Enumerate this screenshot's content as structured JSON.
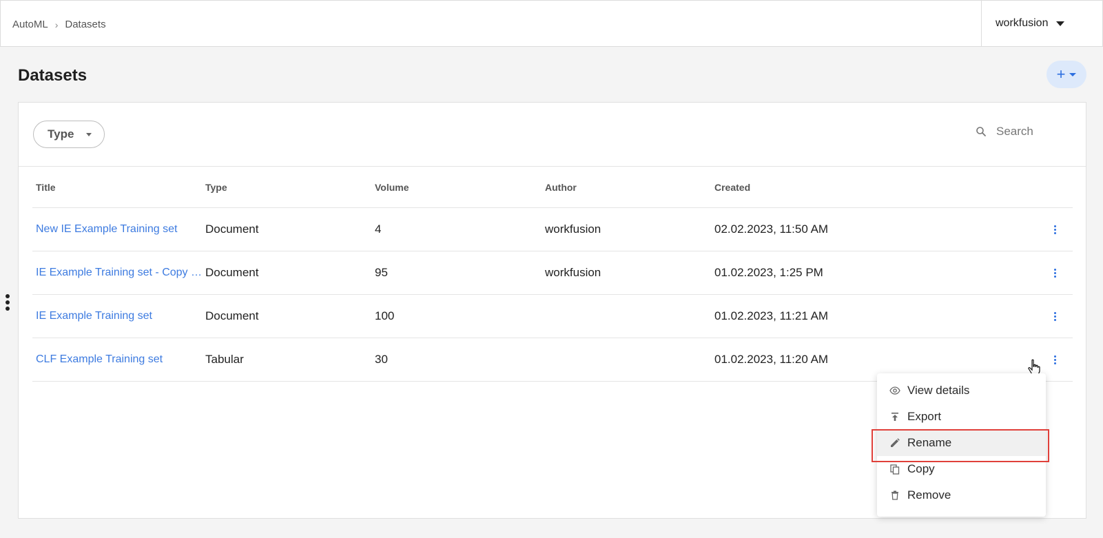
{
  "breadcrumb": {
    "root": "AutoML",
    "current": "Datasets"
  },
  "user": {
    "name": "workfusion"
  },
  "page": {
    "title": "Datasets",
    "add_label": "+"
  },
  "filters": {
    "type_label": "Type",
    "search_placeholder": "Search"
  },
  "table": {
    "headers": [
      "Title",
      "Type",
      "Volume",
      "Author",
      "Created"
    ],
    "rows": [
      {
        "title": "New IE Example Training set",
        "type": "Document",
        "volume": "4",
        "author": "workfusion",
        "created": "02.02.2023, 11:50 AM"
      },
      {
        "title": "IE Example Training set - Copy of IE Example Training set",
        "type": "Document",
        "volume": "95",
        "author": "workfusion",
        "created": "01.02.2023, 1:25 PM"
      },
      {
        "title": "IE Example Training set",
        "type": "Document",
        "volume": "100",
        "author": "",
        "created": "01.02.2023, 11:21 AM"
      },
      {
        "title": "CLF Example Training set",
        "type": "Tabular",
        "volume": "30",
        "author": "",
        "created": "01.02.2023, 11:20 AM"
      }
    ]
  },
  "context_menu": {
    "items": [
      {
        "label": "View details",
        "icon": "eye-icon"
      },
      {
        "label": "Export",
        "icon": "export-icon"
      },
      {
        "label": "Rename",
        "icon": "pencil-icon"
      },
      {
        "label": "Copy",
        "icon": "copy-icon"
      },
      {
        "label": "Remove",
        "icon": "trash-icon"
      }
    ],
    "highlighted": "Rename"
  },
  "colors": {
    "link": "#3d7be0",
    "accent": "#2d6fe0",
    "highlight": "#e0403a"
  }
}
